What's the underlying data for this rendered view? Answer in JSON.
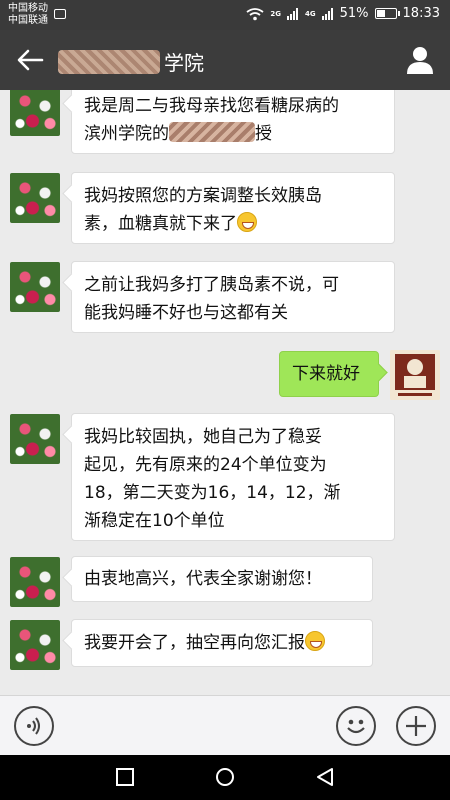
{
  "status": {
    "carrier1": "中国移动",
    "carrier2": "中国联通",
    "net1": "2G",
    "net2": "4G",
    "battery": "51%",
    "battery_level": 0.51,
    "time": "18:33"
  },
  "header": {
    "title_suffix": "学院",
    "back_icon": "back-arrow-icon",
    "profile_icon": "person-icon"
  },
  "messages": [
    {
      "line1": "我是周二与我母亲找您看糖尿病的",
      "line2_prefix": "滨州学院的",
      "line2_suffix": "授"
    },
    {
      "line1": "我妈按照您的方案调整长效胰岛",
      "line2": "素，血糖真就下来了"
    },
    {
      "line1": "之前让我妈多打了胰岛素不说，可",
      "line2": "能我妈睡不好也与这都有关"
    },
    {
      "text": "下来就好"
    },
    {
      "line1": "我妈比较固执，她自己为了稳妥",
      "line2": "起见，先有原来的24个单位变为",
      "line3": "18，第二天变为16，14，12，渐",
      "line4": "渐稳定在10个单位"
    },
    {
      "text": "由衷地高兴，代表全家谢谢您！"
    },
    {
      "text": "我要开会了，抽空再向您汇报"
    }
  ],
  "colors": {
    "header_bg": "#3c3c3c",
    "chat_bg": "#ebebeb",
    "self_bubble": "#9fe658",
    "other_bubble": "#ffffff"
  }
}
